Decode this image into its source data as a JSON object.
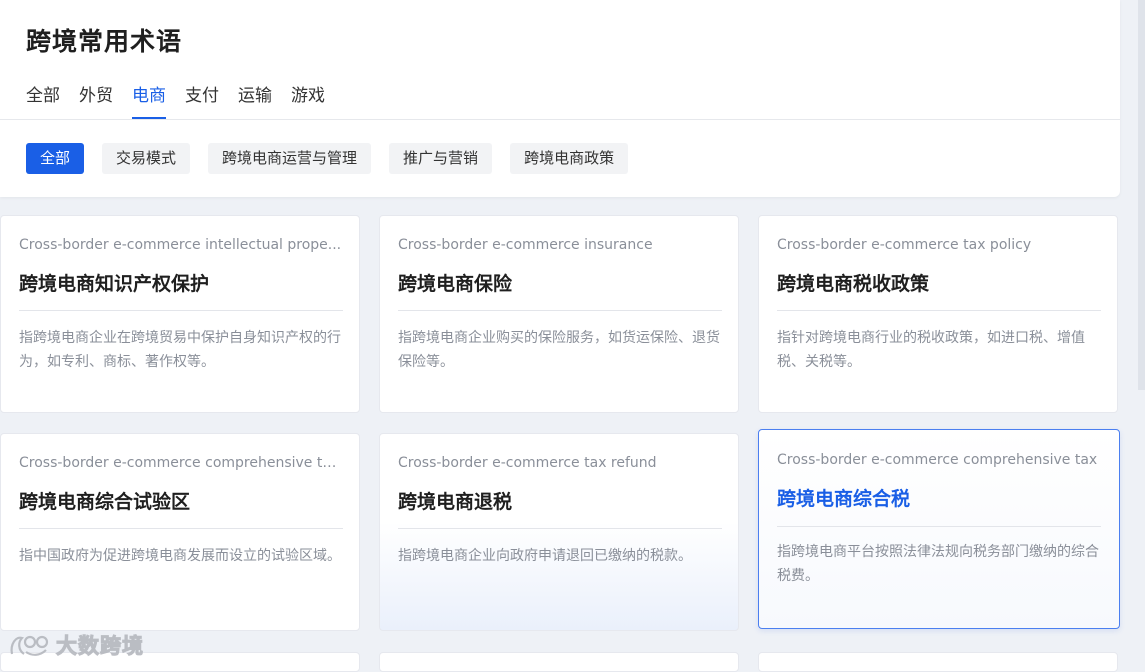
{
  "header": {
    "title": "跨境常用术语"
  },
  "tabs": [
    {
      "label": "全部",
      "active": false
    },
    {
      "label": "外贸",
      "active": false
    },
    {
      "label": "电商",
      "active": true
    },
    {
      "label": "支付",
      "active": false
    },
    {
      "label": "运输",
      "active": false
    },
    {
      "label": "游戏",
      "active": false
    }
  ],
  "chips": [
    {
      "label": "全部",
      "active": true
    },
    {
      "label": "交易模式",
      "active": false
    },
    {
      "label": "跨境电商运营与管理",
      "active": false
    },
    {
      "label": "推广与营销",
      "active": false
    },
    {
      "label": "跨境电商政策",
      "active": false
    }
  ],
  "cards": [
    {
      "en": "Cross-border e-commerce intellectual prope...",
      "cn": "跨境电商知识产权保护",
      "desc": "指跨境电商企业在跨境贸易中保护自身知识产权的行为，如专利、商标、著作权等。",
      "state": "normal"
    },
    {
      "en": "Cross-border e-commerce insurance",
      "cn": "跨境电商保险",
      "desc": "指跨境电商企业购买的保险服务，如货运保险、退货保险等。",
      "state": "normal"
    },
    {
      "en": "Cross-border e-commerce tax policy",
      "cn": "跨境电商税收政策",
      "desc": "指针对跨境电商行业的税收政策，如进口税、增值税、关税等。",
      "state": "normal"
    },
    {
      "en": "Cross-border e-commerce comprehensive te...",
      "cn": "跨境电商综合试验区",
      "desc": "指中国政府为促进跨境电商发展而设立的试验区域。",
      "state": "normal"
    },
    {
      "en": "Cross-border e-commerce tax refund",
      "cn": "跨境电商退税",
      "desc": "指跨境电商企业向政府申请退回已缴纳的税款。",
      "state": "hover"
    },
    {
      "en": "Cross-border e-commerce comprehensive tax",
      "cn": "跨境电商综合税",
      "desc": "指跨境电商平台按照法律法规向税务部门缴纳的综合税费。",
      "state": "selected"
    }
  ],
  "watermark": {
    "text": "大数跨境",
    "icon": "brand-logo-icon"
  },
  "colors": {
    "accent": "#1a5fe6",
    "background": "#eef1f6",
    "card_border_selected": "#4b7ff0"
  }
}
